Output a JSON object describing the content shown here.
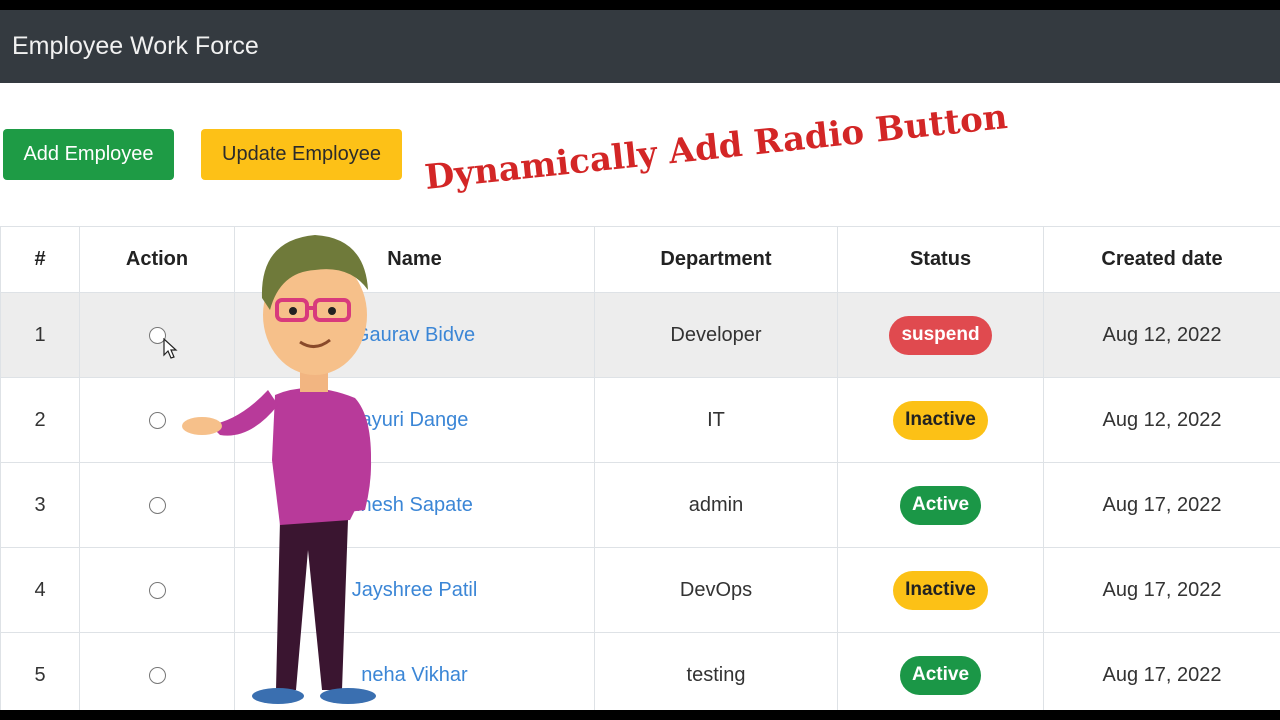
{
  "navbar": {
    "brand": "Employee Work Force"
  },
  "toolbar": {
    "add_label": "Add Employee",
    "update_label": "Update Employee"
  },
  "overlay": {
    "title": "Dynamically Add Radio Button"
  },
  "table": {
    "headers": [
      "#",
      "Action",
      "Name",
      "Department",
      "Status",
      "Created date"
    ],
    "rows": [
      {
        "num": "1",
        "name": "Gaurav Bidve",
        "department": "Developer",
        "status": "suspend",
        "created": "Aug 12, 2022"
      },
      {
        "num": "2",
        "name": "ayuri Dange",
        "department": "IT",
        "status": "Inactive",
        "created": "Aug 12, 2022"
      },
      {
        "num": "3",
        "name": "inesh Sapate",
        "department": "admin",
        "status": "Active",
        "created": "Aug 17, 2022"
      },
      {
        "num": "4",
        "name": "Jayshree Patil",
        "department": "DevOps",
        "status": "Inactive",
        "created": "Aug 17, 2022"
      },
      {
        "num": "5",
        "name": "neha Vikhar",
        "department": "testing",
        "status": "Active",
        "created": "Aug 17, 2022"
      }
    ]
  },
  "colors": {
    "navbar": "#343a40",
    "add_button": "#1e9b45",
    "update_button": "#fdc117",
    "status_suspend": "#e04a4f",
    "status_inactive": "#fcc116",
    "status_active": "#1b9747",
    "link": "#3b86d6",
    "overlay_title": "#d32626"
  },
  "icons": {
    "cursor": "mouse-pointer-icon",
    "mascot": "cartoon-presenter-illustration"
  }
}
